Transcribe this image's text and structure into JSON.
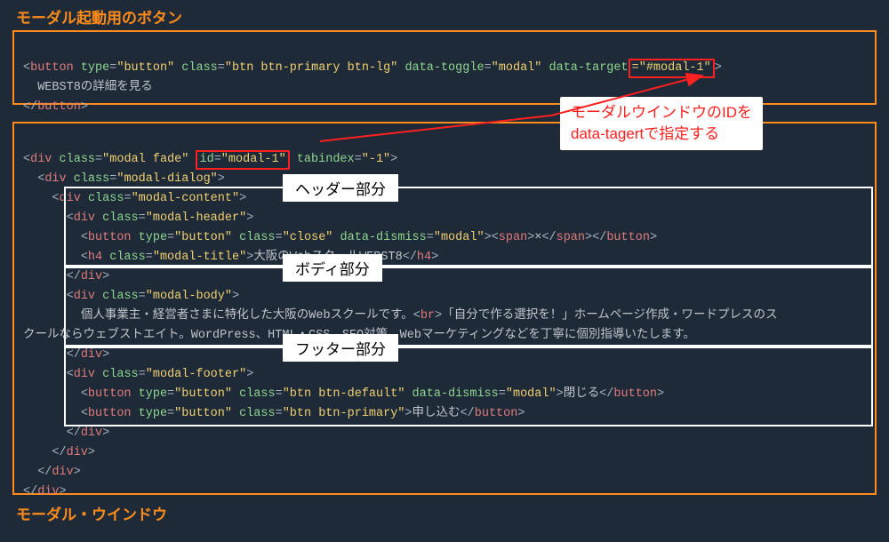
{
  "titles": {
    "top": "モーダル起動用のボタン",
    "bottom": "モーダル・ウインドウ"
  },
  "annotation": {
    "line1": "モーダルウインドウのIDを",
    "line2": "data-tagertで指定する"
  },
  "section_labels": {
    "header": "ヘッダー部分",
    "body": "ボディ部分",
    "footer": "フッター部分"
  },
  "code_top": {
    "button_open": {
      "tag": "button",
      "attrs": [
        {
          "name": "type",
          "value": "\"button\""
        },
        {
          "name": "class",
          "value": "\"btn btn-primary btn-lg\""
        },
        {
          "name": "data-toggle",
          "value": "\"modal\""
        },
        {
          "name": "data-target",
          "value": "=\"#modal-1\""
        }
      ],
      "target_attr_name": "data-target",
      "target_attr_value": "=\"#modal-1\""
    },
    "button_text": "WEBST8の詳細を見る",
    "button_close": "button"
  },
  "code_bottom": {
    "l1": {
      "tag": "div",
      "class": "\"modal fade\"",
      "id_attr": "id=\"modal-1\"",
      "tabindex": "\"-1\""
    },
    "l2": {
      "tag": "div",
      "class": "\"modal-dialog\""
    },
    "l3": {
      "tag": "div",
      "class": "\"modal-content\""
    },
    "l4": {
      "tag": "div",
      "class": "\"modal-header\""
    },
    "l5": {
      "tag": "button",
      "type": "\"button\"",
      "class": "\"close\"",
      "dismiss": "\"modal\"",
      "span_text": "×"
    },
    "l6": {
      "tag": "h4",
      "class": "\"modal-title\"",
      "text": "大阪のWebスクールWEBST8"
    },
    "l7_close": "div",
    "l8": {
      "tag": "div",
      "class": "\"modal-body\""
    },
    "l9": {
      "text_a": "個人事業主・経営者さまに特化した大阪のWebスクールです。",
      "br": "br",
      "text_b": "「自分で作る選択を！」ホームページ作成・ワードプレスのス"
    },
    "l10_text": "クールならウェブストエイト。WordPress、HTML・CSS、SEO対策、Webマーケティングなどを丁寧に個別指導いたします。",
    "l11_close": "div",
    "l12": {
      "tag": "div",
      "class": "\"modal-footer\""
    },
    "l13": {
      "tag": "button",
      "type": "\"button\"",
      "class": "\"btn btn-default\"",
      "dismiss": "\"modal\"",
      "text": "閉じる"
    },
    "l14": {
      "tag": "button",
      "type": "\"button\"",
      "class": "\"btn btn-primary\"",
      "text": "申し込む"
    },
    "l15_close": "div",
    "l16_close": "div",
    "l17_close": "div",
    "l18_close": "div"
  }
}
